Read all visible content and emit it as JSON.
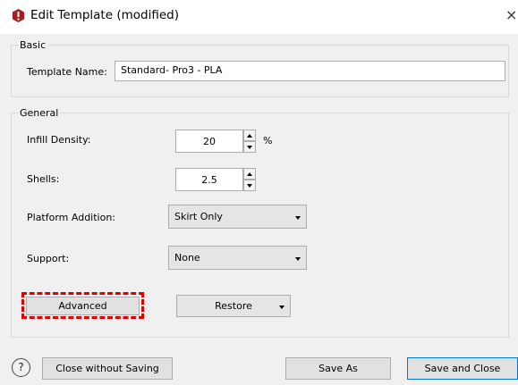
{
  "window": {
    "title": "Edit Template (modified)",
    "close_glyph": "×"
  },
  "basic": {
    "group_title": "Basic",
    "template_name_label": "Template Name:",
    "template_name_value": "Standard- Pro3 - PLA"
  },
  "general": {
    "group_title": "General",
    "infill_density_label": "Infill Density:",
    "infill_density_value": "20",
    "infill_density_unit": "%",
    "shells_label": "Shells:",
    "shells_value": "2.5",
    "platform_addition_label": "Platform Addition:",
    "platform_addition_value": "Skirt Only",
    "support_label": "Support:",
    "support_value": "None",
    "advanced_label": "Advanced",
    "restore_label": "Restore"
  },
  "footer": {
    "help_glyph": "?",
    "close_without_saving_label": "Close without Saving",
    "save_as_label": "Save As",
    "save_and_close_label": "Save and Close"
  },
  "colors": {
    "highlight": "#e00000",
    "primary_border": "#0078d7",
    "app_icon": "#a31f24"
  },
  "icons": [
    "app-logo-icon",
    "close-icon",
    "spin-up-icon",
    "spin-down-icon",
    "chevron-down-icon",
    "help-icon"
  ]
}
